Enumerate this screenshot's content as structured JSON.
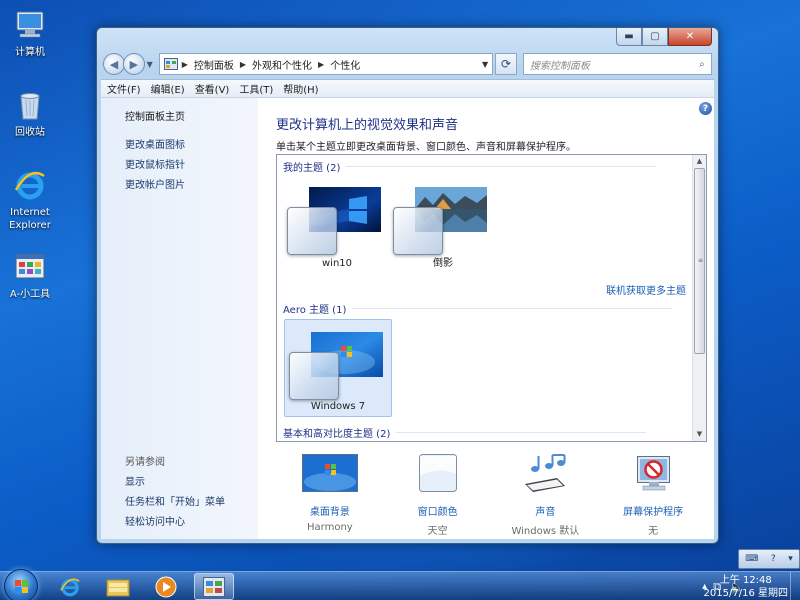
{
  "desktop": {
    "icons": [
      {
        "label": "计算机",
        "icon": "computer-icon"
      },
      {
        "label": "回收站",
        "icon": "recycle-bin-icon"
      },
      {
        "label": "Internet",
        "label2": "Explorer",
        "icon": "ie-icon"
      },
      {
        "label": "A-小工具",
        "icon": "tools-icon"
      }
    ]
  },
  "window": {
    "controls": {
      "minimize": "▬",
      "maximize": "▢",
      "close": "✕"
    },
    "breadcrumb": [
      "控制面板",
      "外观和个性化",
      "个性化"
    ],
    "search_placeholder": "搜索控制面板",
    "menu": [
      "文件(F)",
      "编辑(E)",
      "查看(V)",
      "工具(T)",
      "帮助(H)"
    ],
    "left_pane": {
      "home": "控制面板主页",
      "links": [
        "更改桌面图标",
        "更改鼠标指针",
        "更改帐户图片"
      ],
      "see_also_title": "另请参阅",
      "see_also": [
        "显示",
        "任务栏和「开始」菜单",
        "轻松访问中心"
      ]
    },
    "main": {
      "title": "更改计算机上的视觉效果和声音",
      "description": "单击某个主题立即更改桌面背景、窗口颜色、声音和屏幕保护程序。",
      "groups": {
        "my_themes": "我的主题 (2)",
        "aero_themes": "Aero 主题 (1)",
        "basic_themes": "基本和高对比度主题 (2)"
      },
      "themes": [
        {
          "name": "win10",
          "group": "my_themes"
        },
        {
          "name": "倒影",
          "group": "my_themes"
        },
        {
          "name": "Windows 7",
          "group": "aero_themes",
          "selected": true
        }
      ],
      "more_link": "联机获取更多主题",
      "bottom": [
        {
          "label": "桌面背景",
          "value": "Harmony",
          "icon": "desktop-background-icon"
        },
        {
          "label": "窗口颜色",
          "value": "天空",
          "icon": "window-color-icon"
        },
        {
          "label": "声音",
          "value": "Windows 默认",
          "icon": "sounds-icon"
        },
        {
          "label": "屏幕保护程序",
          "value": "无",
          "icon": "screensaver-icon"
        }
      ]
    }
  },
  "taskbar": {
    "time": "上午 12:48",
    "date": "2015/7/16 星期四",
    "buttons": [
      "ie-icon",
      "explorer-icon",
      "media-player-icon",
      "control-panel-icon"
    ]
  },
  "colors": {
    "title_blue": "#1e3287",
    "link_blue": "#1c5fb8",
    "desktop": "#1872d8"
  }
}
